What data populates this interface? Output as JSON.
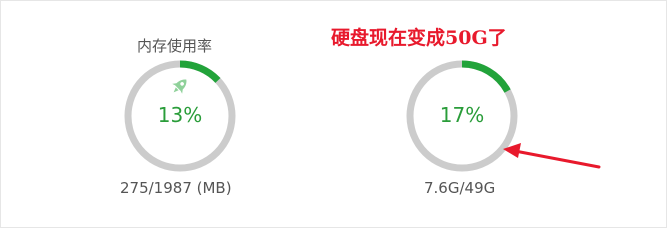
{
  "memory": {
    "title": "内存使用率",
    "percent_text": "13%",
    "percent": 13,
    "usage_text": "275/1987 (MB)",
    "icon": "rocket-icon"
  },
  "disk": {
    "title": "",
    "percent_text": "17%",
    "percent": 17,
    "usage_text": "7.6G/49G"
  },
  "annotation": {
    "text": "硬盘现在变成50G了"
  },
  "colors": {
    "track": "#cccccc",
    "progress": "#22a33a",
    "percent_text": "#2a9d3a",
    "annotation": "#e8192c",
    "icon": "#8fd19a"
  }
}
